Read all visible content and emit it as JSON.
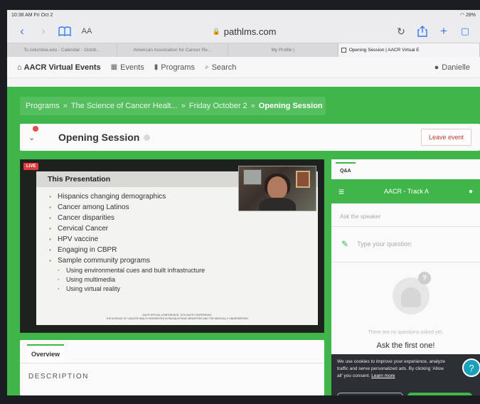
{
  "status_bar": {
    "time": "10:38 AM  Fri Oct 2",
    "battery": "28%"
  },
  "browser": {
    "url": "pathlms.com",
    "reader_label": "AA",
    "tabs": [
      {
        "label": "Tc.columbia.edu - Calendar - Octob..."
      },
      {
        "label": "American Association for Cancer Re..."
      },
      {
        "label": "My Profile |"
      },
      {
        "label": "Opening Session | AACR Virtual E"
      }
    ]
  },
  "site_nav": {
    "brand": "AACR Virtual Events",
    "events": "Events",
    "programs": "Programs",
    "search": "Search",
    "user": "Danielle"
  },
  "breadcrumb": {
    "items": [
      "Programs",
      "The Science of Cancer Healt...",
      "Friday October 2"
    ],
    "current": "Opening Session",
    "separator": "»"
  },
  "session": {
    "title": "Opening Session",
    "leave_label": "Leave event"
  },
  "video": {
    "live_badge": "LIVE",
    "slide_title": "This Presentation",
    "bullets": [
      "Hispanics changing demographics",
      "Cancer among Latinos",
      "Cancer disparities",
      "Cervical Cancer",
      "HPV vaccine",
      "Engaging in CBPR",
      "Sample community programs"
    ],
    "sub_bullets": [
      "Using environmental cues and built infrastructure",
      "Using multimedia",
      "Using virtual reality"
    ],
    "footer_line1": "AACR VIRTUAL CONFERENCE: 13TH AACR CONFERENCE",
    "footer_line2": "THE SCIENCE OF CANCER HEALTH DISPARITIES IN RACIAL/ETHNIC MINORITIES AND THE MEDICALLY UNDERSERVED"
  },
  "overview": {
    "tab": "Overview",
    "description_heading": "DESCRIPTION"
  },
  "qa": {
    "tab": "Q&A",
    "track": "AACR - Track A",
    "ask_speaker": "Ask the speaker",
    "placeholder": "Type your question",
    "no_questions": "There are no questions asked yet.",
    "ask_first": "Ask the first one!"
  },
  "cookie": {
    "text": "We use cookies to improve your experience, analyze traffic and serve personalized ads. By clicking 'Allow all' you consent.",
    "learn_more": "Learn more"
  },
  "colors": {
    "accent_green": "#3fb54a",
    "leave_red": "#c0392b",
    "live_red": "#e23b3b",
    "help_teal": "#1aa0b8"
  }
}
